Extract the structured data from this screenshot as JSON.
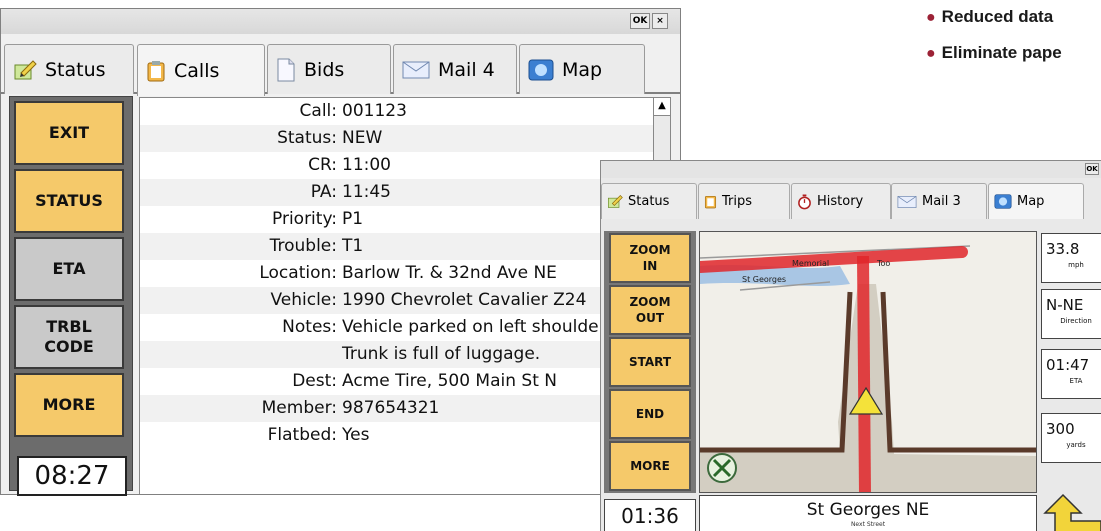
{
  "bullets": [
    "Reduced data",
    "Eliminate pape"
  ],
  "calls_window": {
    "ok": "OK",
    "close": "×",
    "tabs": [
      {
        "label": "Status",
        "icon": "status-pencil-icon"
      },
      {
        "label": "Calls",
        "icon": "clipboard-icon"
      },
      {
        "label": "Bids",
        "icon": "document-icon"
      },
      {
        "label": "Mail 4",
        "icon": "envelope-icon"
      },
      {
        "label": "Map",
        "icon": "globe-icon"
      }
    ],
    "buttons": [
      {
        "label": "EXIT",
        "style": "yellow"
      },
      {
        "label": "STATUS",
        "style": "yellow"
      },
      {
        "label": "ETA",
        "style": "gray"
      },
      {
        "label": "TRBL\nCODE",
        "style": "gray"
      },
      {
        "label": "MORE",
        "style": "yellow"
      }
    ],
    "clock": "08:27",
    "details": [
      {
        "label": "Call:",
        "value": "001123"
      },
      {
        "label": "Status:",
        "value": "NEW"
      },
      {
        "label": "CR:",
        "value": "11:00"
      },
      {
        "label": "PA:",
        "value": "11:45"
      },
      {
        "label": "Priority:",
        "value": "P1"
      },
      {
        "label": "Trouble:",
        "value": "T1"
      },
      {
        "label": "Location:",
        "value": "Barlow Tr. & 32nd Ave NE"
      },
      {
        "label": "Vehicle:",
        "value": "1990 Chevrolet Cavalier Z24"
      },
      {
        "label": "Notes:",
        "value": "Vehicle parked on left shoulde"
      },
      {
        "label": "",
        "value": "Trunk is full of luggage."
      },
      {
        "label": "Dest:",
        "value": "Acme Tire, 500 Main St N"
      },
      {
        "label": "Member:",
        "value": "987654321"
      },
      {
        "label": "Flatbed:",
        "value": "Yes"
      }
    ]
  },
  "map_window": {
    "ok": "OK",
    "tabs": [
      {
        "label": "Status",
        "icon": "status-pencil-icon"
      },
      {
        "label": "Trips",
        "icon": "clipboard-icon"
      },
      {
        "label": "History",
        "icon": "stopwatch-icon"
      },
      {
        "label": "Mail 3",
        "icon": "envelope-icon"
      },
      {
        "label": "Map",
        "icon": "globe-icon"
      }
    ],
    "buttons": [
      {
        "label": "ZOOM\nIN"
      },
      {
        "label": "ZOOM\nOUT"
      },
      {
        "label": "START"
      },
      {
        "label": "END"
      },
      {
        "label": "MORE"
      }
    ],
    "map_labels": {
      "road1": "Memorial",
      "road2": "Too",
      "road3": "St Georges"
    },
    "info": [
      {
        "value": "33.8",
        "unit": "mph"
      },
      {
        "value": "N-NE",
        "unit": "Direction"
      },
      {
        "value": "01:47",
        "unit": "ETA"
      },
      {
        "value": "300",
        "unit": "yards"
      }
    ],
    "clock": "01:36",
    "street": "St Georges NE",
    "next_street_label": "Next Street",
    "colors": {
      "route": "#e0262a",
      "button": "#f5c96a"
    }
  }
}
